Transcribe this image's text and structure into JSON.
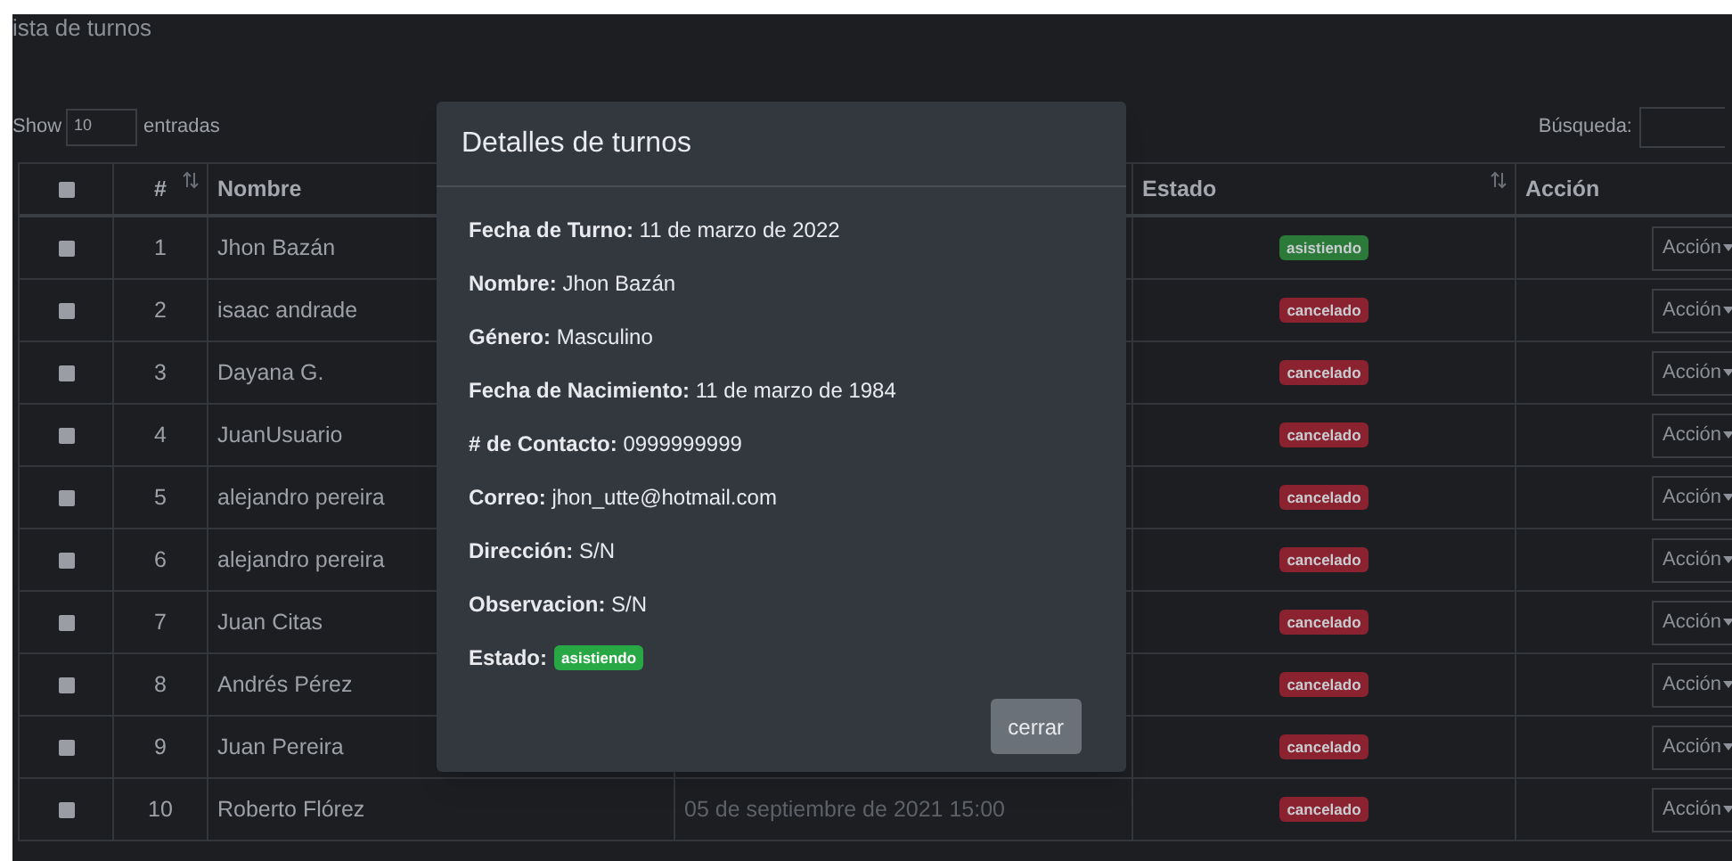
{
  "page": {
    "title": "ista de turnos"
  },
  "length_control": {
    "label_before": "Show",
    "value": "10",
    "label_after": "entradas"
  },
  "search": {
    "label": "Búsqueda:"
  },
  "table": {
    "header_checkbox": {
      "checked": false
    },
    "columns": [
      {
        "label": "#",
        "sortable": true
      },
      {
        "label": "Nombre"
      },
      {
        "label": "Estado",
        "sortable": true
      },
      {
        "label": "Acción"
      }
    ],
    "rows": [
      {
        "checked": false,
        "number": "1",
        "name": "Jhon Bazán",
        "status": "asistiendo",
        "color": "#2b7a3a",
        "action": "Acción"
      },
      {
        "checked": false,
        "number": "2",
        "name": "isaac andrade",
        "status": "cancelado",
        "color": "#8a2230",
        "action": "Acción"
      },
      {
        "checked": false,
        "number": "3",
        "name": "Dayana G.",
        "status": "cancelado",
        "color": "#8a2230",
        "action": "Acción"
      },
      {
        "checked": false,
        "number": "4",
        "name": "JuanUsuario",
        "status": "cancelado",
        "color": "#8a2230",
        "action": "Acción"
      },
      {
        "checked": false,
        "number": "5",
        "name": "alejandro pereira",
        "status": "cancelado",
        "color": "#8a2230",
        "action": "Acción"
      },
      {
        "checked": false,
        "number": "6",
        "name": "alejandro pereira",
        "status": "cancelado",
        "color": "#8a2230",
        "action": "Acción"
      },
      {
        "checked": false,
        "number": "7",
        "name": "Juan Citas",
        "status": "cancelado",
        "color": "#8a2230",
        "action": "Acción"
      },
      {
        "checked": false,
        "number": "8",
        "name": "Andrés Pérez",
        "status": "cancelado",
        "color": "#8a2230",
        "action": "Acción"
      },
      {
        "checked": false,
        "number": "9",
        "name": "Juan Pereira",
        "status": "cancelado",
        "color": "#8a2230",
        "action": "Acción"
      },
      {
        "checked": false,
        "number": "10",
        "name": "Roberto Flórez",
        "date": "05 de septiembre de 2021 15:00",
        "status": "cancelado",
        "color": "#8a2230",
        "action": "Acción"
      }
    ]
  },
  "modal": {
    "title": "Detalles de turnos",
    "fields": [
      {
        "kind": "text",
        "label": "Fecha de Turno:",
        "value": "11 de marzo de 2022"
      },
      {
        "kind": "text",
        "label": "Nombre:",
        "value": "Jhon Bazán"
      },
      {
        "kind": "text",
        "label": "Género:",
        "value": "Masculino"
      },
      {
        "kind": "text",
        "label": "Fecha de Nacimiento:",
        "value": "11 de marzo de 1984"
      },
      {
        "kind": "text",
        "label": "# de Contacto:",
        "value": "0999999999"
      },
      {
        "kind": "text",
        "label": "Correo:",
        "value": "jhon_utte@hotmail.com"
      },
      {
        "kind": "text",
        "label": "Dirección:",
        "value": "S/N"
      },
      {
        "kind": "text",
        "label": "Observacion:",
        "value": "S/N"
      },
      {
        "kind": "badge",
        "label": "Estado:",
        "value": "asistiendo",
        "color": "#28a745"
      }
    ],
    "close_button": "cerrar"
  }
}
